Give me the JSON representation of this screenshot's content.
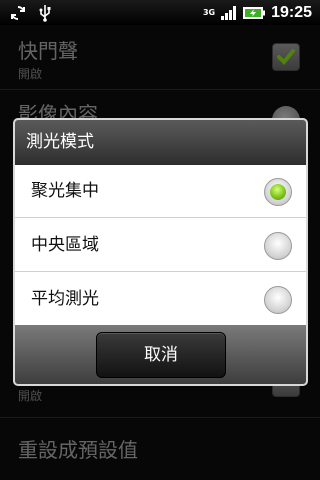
{
  "status_bar": {
    "network": "3G",
    "time": "19:25",
    "icons": [
      "sync-icon",
      "usb-icon",
      "network-3g-icon",
      "signal-icon",
      "battery-charging-icon"
    ]
  },
  "settings": {
    "shutter_sound": {
      "title": "快門聲",
      "subtitle": "開啟",
      "checked": true
    },
    "image_content": {
      "title": "影像內容"
    },
    "hidden_row": {
      "subtitle": "開啟"
    },
    "reset_defaults": {
      "title": "重設成預設值"
    }
  },
  "dialog": {
    "title": "測光模式",
    "options": [
      {
        "label": "聚光集中",
        "selected": true
      },
      {
        "label": "中央區域",
        "selected": false
      },
      {
        "label": "平均測光",
        "selected": false
      }
    ],
    "cancel_label": "取消"
  },
  "colors": {
    "accent_green": "#7ec51d",
    "header_dark": "#2e2e2e"
  }
}
